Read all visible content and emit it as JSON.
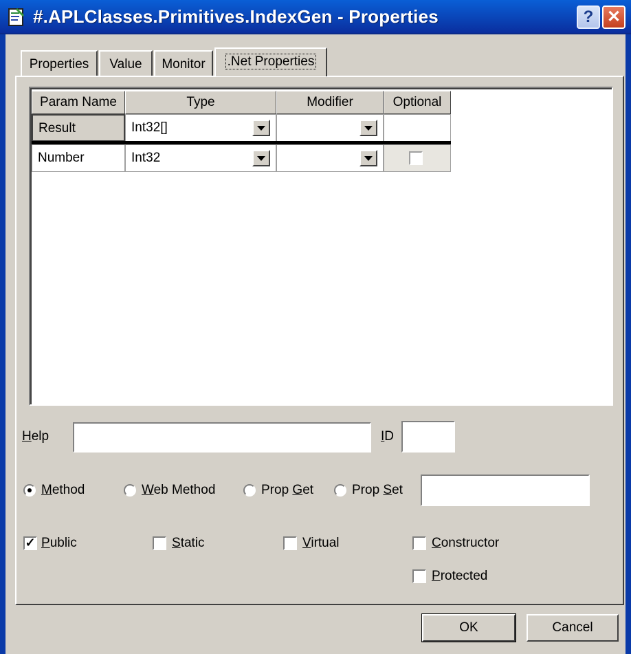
{
  "window": {
    "title": "#.APLClasses.Primitives.IndexGen - Properties",
    "help_button": "?",
    "close_button": "✕"
  },
  "tabs": [
    {
      "label": "Properties",
      "active": false
    },
    {
      "label": "Value",
      "active": false
    },
    {
      "label": "Monitor",
      "active": false
    },
    {
      "label": ".Net Properties",
      "active": true
    }
  ],
  "grid": {
    "columns": [
      "Param Name",
      "Type",
      "Modifier",
      "Optional"
    ],
    "rows": [
      {
        "param_name": "Result",
        "type": "Int32[]",
        "modifier": "",
        "optional": null
      },
      {
        "param_name": "Number",
        "type": "Int32",
        "modifier": "",
        "optional": false
      }
    ]
  },
  "help": {
    "label_accel": "H",
    "label_rest": "elp",
    "value": ""
  },
  "id": {
    "label_accel": "I",
    "label_rest": "D",
    "value": ""
  },
  "kind": {
    "options": [
      {
        "pre": "",
        "accel": "M",
        "rest": "ethod",
        "selected": true
      },
      {
        "pre": "",
        "accel": "W",
        "rest": "eb Method",
        "selected": false
      },
      {
        "pre": "Prop ",
        "accel": "G",
        "rest": "et",
        "selected": false
      },
      {
        "pre": "Prop ",
        "accel": "S",
        "rest": "et",
        "selected": false
      }
    ],
    "property_name_value": ""
  },
  "flags": [
    {
      "accel": "P",
      "rest": "ublic",
      "checked": true
    },
    {
      "accel": "S",
      "rest": "tatic",
      "checked": false
    },
    {
      "accel": "V",
      "rest": "irtual",
      "checked": false
    },
    {
      "accel": "C",
      "rest": "onstructor",
      "checked": false
    },
    {
      "accel": "P",
      "rest": "rotected",
      "checked": false
    }
  ],
  "buttons": {
    "ok": "OK",
    "cancel": "Cancel"
  },
  "colors": {
    "titlebar": "#0a4cc4",
    "dialog_bg": "#d4d0c8",
    "close_red": "#d4502e"
  }
}
